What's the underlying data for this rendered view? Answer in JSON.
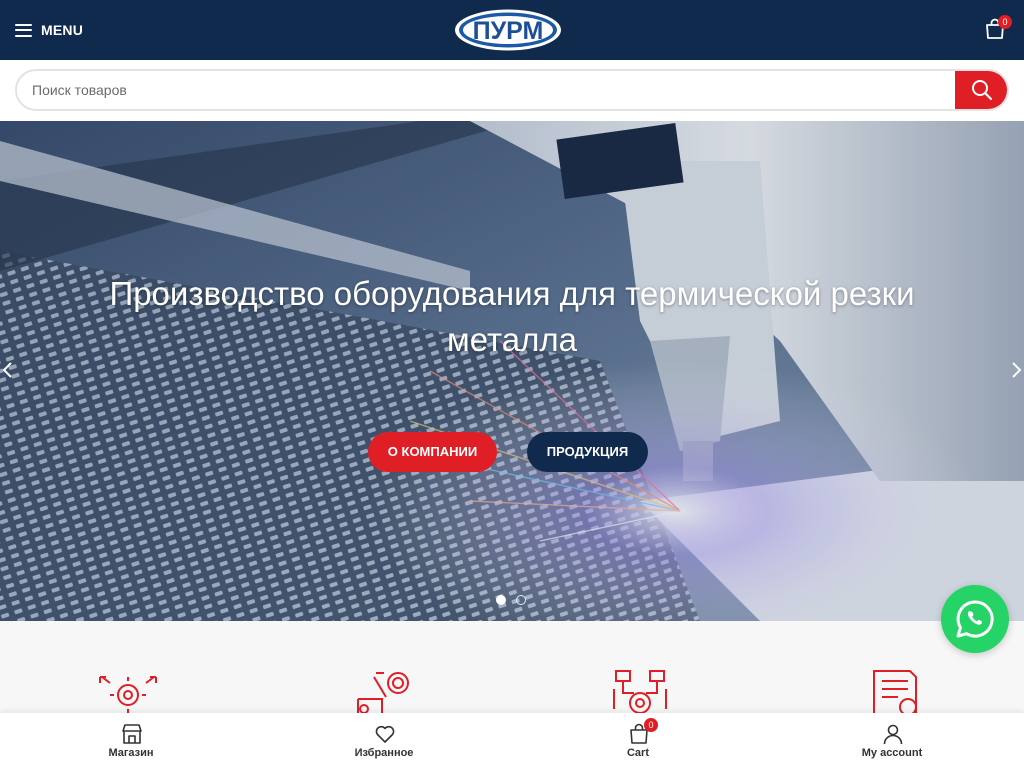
{
  "header": {
    "menu_label": "MENU",
    "logo_text": "ПУРМ",
    "cart_count": "0"
  },
  "search": {
    "placeholder": "Поиск товаров"
  },
  "hero": {
    "title": "Производство оборудования для термической резки металла",
    "buttons": {
      "about": "О КОМПАНИИ",
      "products": "ПРОДУКЦИЯ"
    },
    "active_slide": 1,
    "slide_count": 2
  },
  "features": {
    "icons": [
      "gear-arrows-icon",
      "design-tools-icon",
      "circuit-gear-icon",
      "certificate-icon"
    ]
  },
  "bottom_nav": {
    "items": [
      {
        "label": "Магазин",
        "icon": "store-icon"
      },
      {
        "label": "Избранное",
        "icon": "heart-icon"
      },
      {
        "label": "Cart",
        "icon": "cart-icon",
        "badge": "0"
      },
      {
        "label": "My account",
        "icon": "user-icon"
      }
    ]
  },
  "colors": {
    "navy": "#0f2a4d",
    "accent_red": "#e01e26",
    "whatsapp_green": "#25d366"
  }
}
